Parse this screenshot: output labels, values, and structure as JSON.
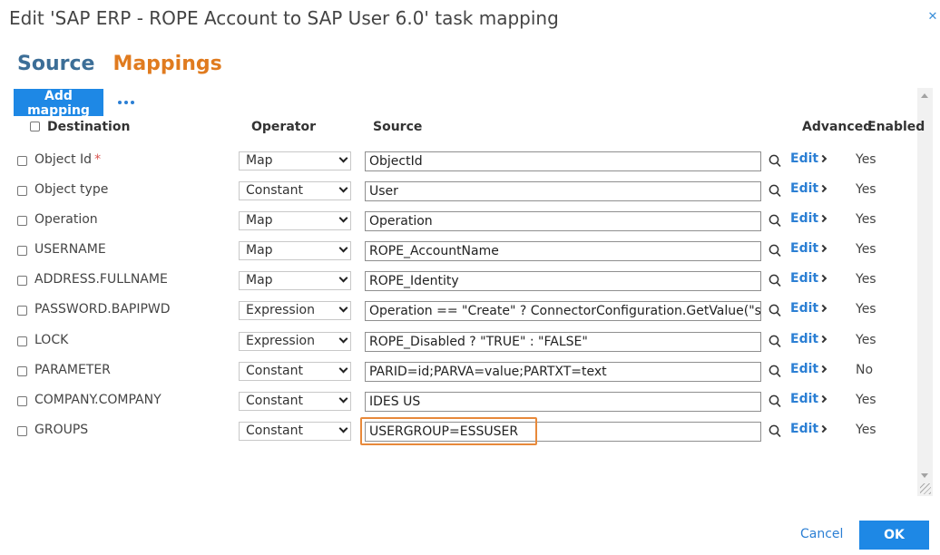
{
  "dialog": {
    "title": "Edit 'SAP ERP - ROPE Account to SAP User 6.0' task mapping",
    "close_icon": "close-icon"
  },
  "tabs": {
    "source": "Source",
    "mappings": "Mappings"
  },
  "toolbar": {
    "add_mapping": "Add mapping",
    "more_icon": "more-dots-icon"
  },
  "columns": {
    "destination": "Destination",
    "operator": "Operator",
    "source": "Source",
    "advanced": "Advanced",
    "enabled": "Enabled"
  },
  "rows": [
    {
      "destination": "Object Id",
      "required": "*",
      "operator": "Map",
      "source": "ObjectId",
      "edit": "Edit",
      "enabled": "Yes"
    },
    {
      "destination": "Object type",
      "operator": "Constant",
      "source": "User",
      "edit": "Edit",
      "enabled": "Yes"
    },
    {
      "destination": "Operation",
      "operator": "Map",
      "source": "Operation",
      "edit": "Edit",
      "enabled": "Yes"
    },
    {
      "destination": "USERNAME",
      "operator": "Map",
      "source": "ROPE_AccountName",
      "edit": "Edit",
      "enabled": "Yes"
    },
    {
      "destination": "ADDRESS.FULLNAME",
      "operator": "Map",
      "source": "ROPE_Identity",
      "edit": "Edit",
      "enabled": "Yes"
    },
    {
      "destination": "PASSWORD.BAPIPWD",
      "operator": "Expression",
      "source": "Operation == \"Create\" ? ConnectorConfiguration.GetValue(\"sap",
      "edit": "Edit",
      "enabled": "Yes"
    },
    {
      "destination": "LOCK",
      "operator": "Expression",
      "source": "ROPE_Disabled ? \"TRUE\" : \"FALSE\"",
      "edit": "Edit",
      "enabled": "Yes"
    },
    {
      "destination": "PARAMETER",
      "operator": "Constant",
      "source": "PARID=id;PARVA=value;PARTXT=text",
      "edit": "Edit",
      "enabled": "No"
    },
    {
      "destination": "COMPANY.COMPANY",
      "operator": "Constant",
      "source": "IDES US",
      "edit": "Edit",
      "enabled": "Yes"
    },
    {
      "destination": "GROUPS",
      "operator": "Constant",
      "source": "USERGROUP=ESSUSER",
      "edit": "Edit",
      "enabled": "Yes",
      "highlighted": true
    }
  ],
  "footer": {
    "cancel": "Cancel",
    "ok": "OK"
  },
  "colors": {
    "accent_blue": "#1e88e5",
    "mappings_orange": "#e07b1f",
    "source_blue": "#3c6e97",
    "highlight": "#e8893a"
  }
}
